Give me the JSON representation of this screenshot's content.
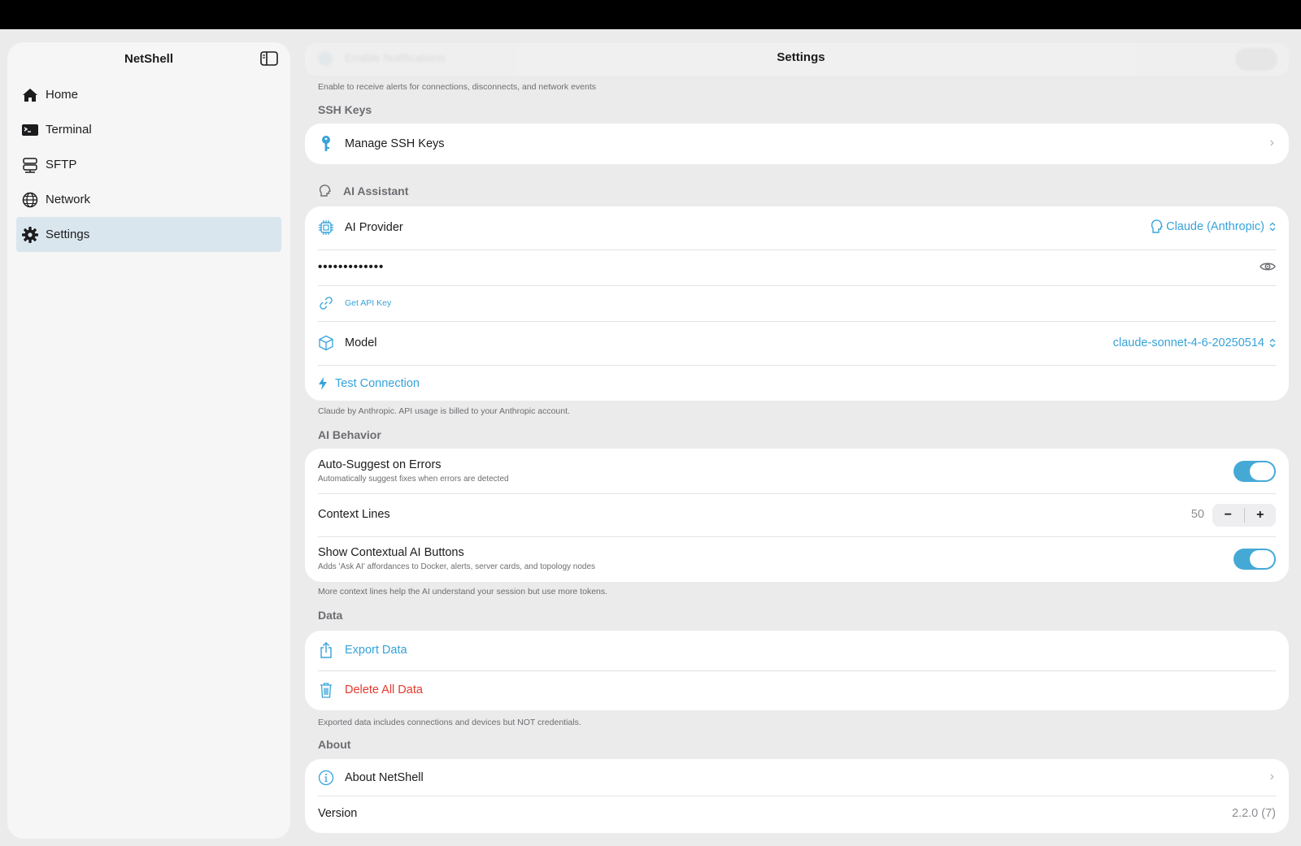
{
  "sidebar": {
    "title": "NetShell",
    "items": [
      {
        "label": "Home",
        "icon": "house-icon"
      },
      {
        "label": "Terminal",
        "icon": "terminal-icon"
      },
      {
        "label": "SFTP",
        "icon": "server-stack-icon"
      },
      {
        "label": "Network",
        "icon": "globe-icon"
      },
      {
        "label": "Settings",
        "icon": "gear-icon",
        "active": true
      }
    ]
  },
  "header": {
    "title": "Settings",
    "faded_row_label": "Enable Notifications"
  },
  "notifications": {
    "footnote": "Enable to receive alerts for connections, disconnects, and network events"
  },
  "ssh_keys": {
    "header": "SSH Keys",
    "manage_label": "Manage SSH Keys"
  },
  "ai_assistant": {
    "header": "AI Assistant",
    "provider_label": "AI Provider",
    "provider_value": "Claude (Anthropic)",
    "api_key_masked": "•••••••••••••",
    "get_api_key": "Get API Key",
    "model_label": "Model",
    "model_value": "claude-sonnet-4-6-20250514",
    "test_connection": "Test Connection",
    "footnote": "Claude by Anthropic. API usage is billed to your Anthropic account."
  },
  "ai_behavior": {
    "header": "AI Behavior",
    "auto_suggest_label": "Auto-Suggest on Errors",
    "auto_suggest_sub": "Automatically suggest fixes when errors are detected",
    "auto_suggest_on": true,
    "context_lines_label": "Context Lines",
    "context_lines_value": "50",
    "stepper_minus": "−",
    "stepper_plus": "+",
    "contextual_label": "Show Contextual AI Buttons",
    "contextual_sub": "Adds 'Ask AI' affordances to Docker, alerts, server cards, and topology nodes",
    "contextual_on": true,
    "footnote": "More context lines help the AI understand your session but use more tokens."
  },
  "data_section": {
    "header": "Data",
    "export_label": "Export Data",
    "delete_label": "Delete All Data",
    "footnote": "Exported data includes connections and devices but NOT credentials."
  },
  "about": {
    "header": "About",
    "about_label": "About NetShell",
    "version_label": "Version",
    "version_value": "2.2.0 (7)"
  },
  "colors": {
    "accent": "#36a3d9",
    "danger": "#e5392d",
    "toggle_on": "#45a9d6",
    "sidebar_active": "#dae6ee"
  }
}
